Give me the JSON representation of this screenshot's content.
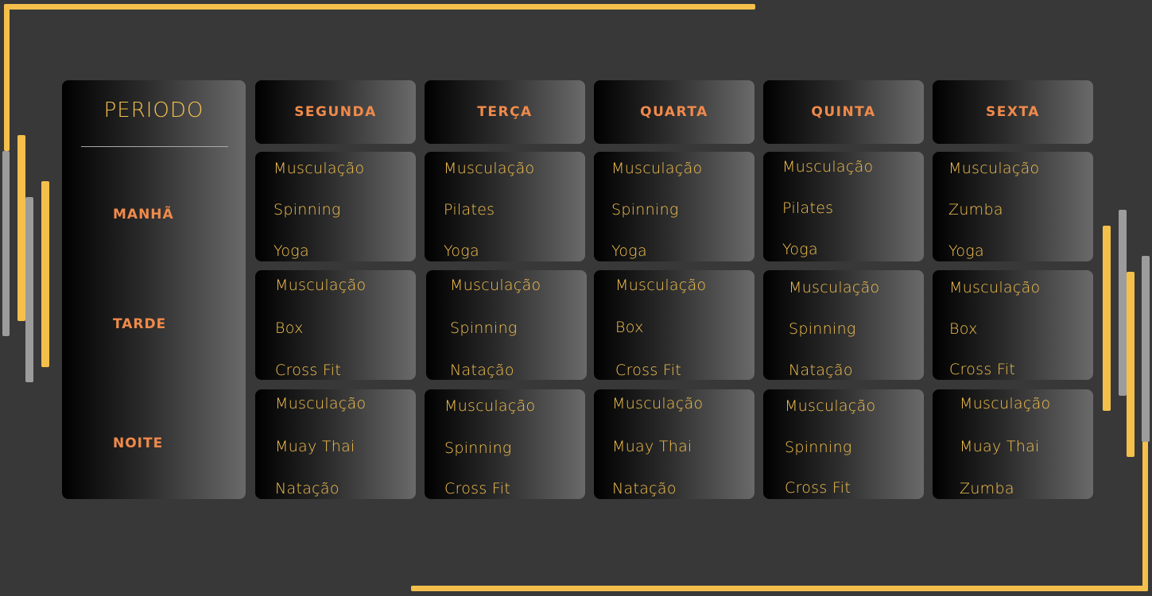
{
  "period_header": "PERIODO",
  "periods": [
    "MANHÃ",
    "TARDE",
    "NOITE"
  ],
  "days": [
    "SEGUNDA",
    "TERÇA",
    "QUARTA",
    "QUINTA",
    "SEXTA"
  ],
  "schedule": [
    [
      [
        "Musculação",
        "Spinning",
        "Yoga"
      ],
      [
        "Musculação",
        "Pilates",
        "Yoga"
      ],
      [
        "Musculação",
        "Spinning",
        "Yoga"
      ],
      [
        "Musculação",
        "Pilates",
        "Yoga"
      ],
      [
        "Musculação",
        "Zumba",
        "Yoga"
      ]
    ],
    [
      [
        "Musculação",
        "Box",
        "Cross Fit"
      ],
      [
        "Musculação",
        "Spinning",
        "Natação"
      ],
      [
        "Musculação",
        "Box",
        "Cross Fit"
      ],
      [
        "Musculação",
        "Spinning",
        "Natação"
      ],
      [
        "Musculação",
        "Box",
        "Cross Fit"
      ]
    ],
    [
      [
        "Musculação",
        "Muay Thai",
        "Natação"
      ],
      [
        "Musculação",
        "Spinning",
        "Cross Fit"
      ],
      [
        "Musculação",
        "Muay Thai",
        "Natação"
      ],
      [
        "Musculação",
        "Spinning",
        "Cross Fit"
      ],
      [
        "Musculação",
        "Muay Thai",
        "Zumba"
      ]
    ]
  ],
  "colors": {
    "background": "#383838",
    "accent_yellow": "#f4c04b",
    "header_orange": "#f08a4b",
    "activity_text": "#f6c24f"
  }
}
